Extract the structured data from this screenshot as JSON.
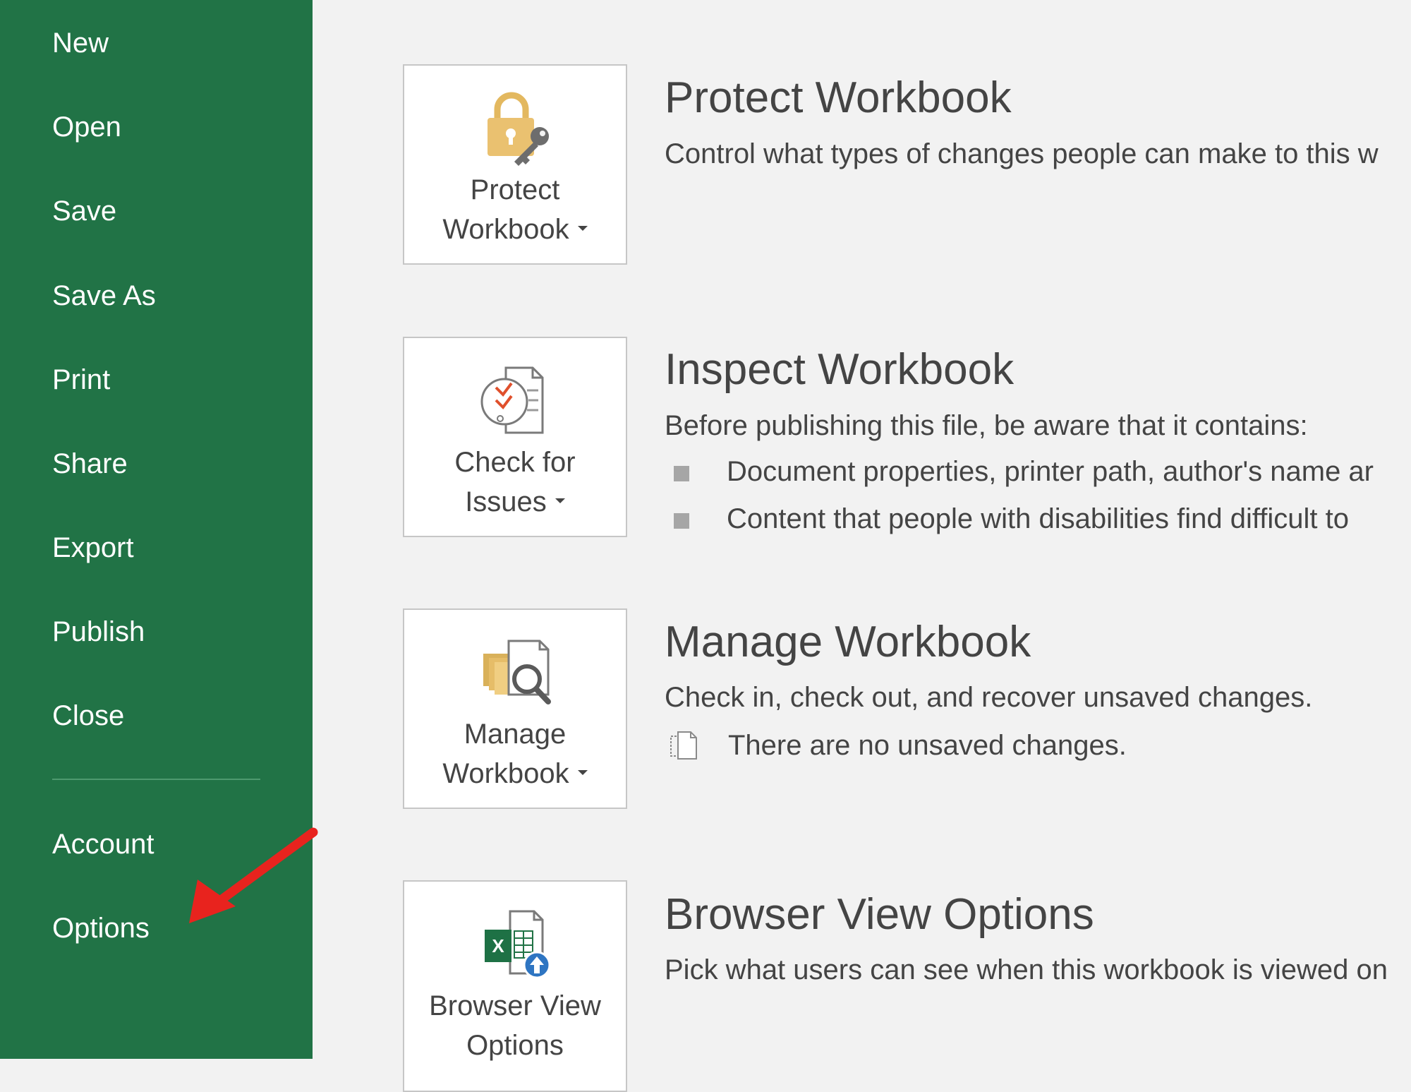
{
  "sidebar": {
    "items": [
      {
        "label": "New"
      },
      {
        "label": "Open"
      },
      {
        "label": "Save"
      },
      {
        "label": "Save As"
      },
      {
        "label": "Print"
      },
      {
        "label": "Share"
      },
      {
        "label": "Export"
      },
      {
        "label": "Publish"
      },
      {
        "label": "Close"
      },
      {
        "label": "Account"
      },
      {
        "label": "Options"
      }
    ],
    "background_color": "#217346"
  },
  "annotation": {
    "arrow_color": "#e8231e",
    "points_to": "Options"
  },
  "sections": [
    {
      "button": {
        "line1": "Protect",
        "line2": "Workbook",
        "has_dropdown": true,
        "icon": "lock-key-icon"
      },
      "title": "Protect Workbook",
      "description": "Control what types of changes people can make to this w"
    },
    {
      "button": {
        "line1": "Check for",
        "line2": "Issues",
        "has_dropdown": true,
        "icon": "inspect-document-icon"
      },
      "title": "Inspect Workbook",
      "description": "Before publishing this file, be aware that it contains:",
      "bullets": [
        "Document properties, printer path, author's name ar",
        "Content that people with disabilities find difficult to"
      ]
    },
    {
      "button": {
        "line1": "Manage",
        "line2": "Workbook",
        "has_dropdown": true,
        "icon": "manage-versions-icon"
      },
      "title": "Manage Workbook",
      "description": "Check in, check out, and recover unsaved changes.",
      "note": "There are no unsaved changes."
    },
    {
      "button": {
        "line1": "Browser View",
        "line2": "Options",
        "has_dropdown": false,
        "icon": "excel-browser-view-icon"
      },
      "title": "Browser View Options",
      "description": "Pick what users can see when this workbook is viewed on"
    }
  ]
}
